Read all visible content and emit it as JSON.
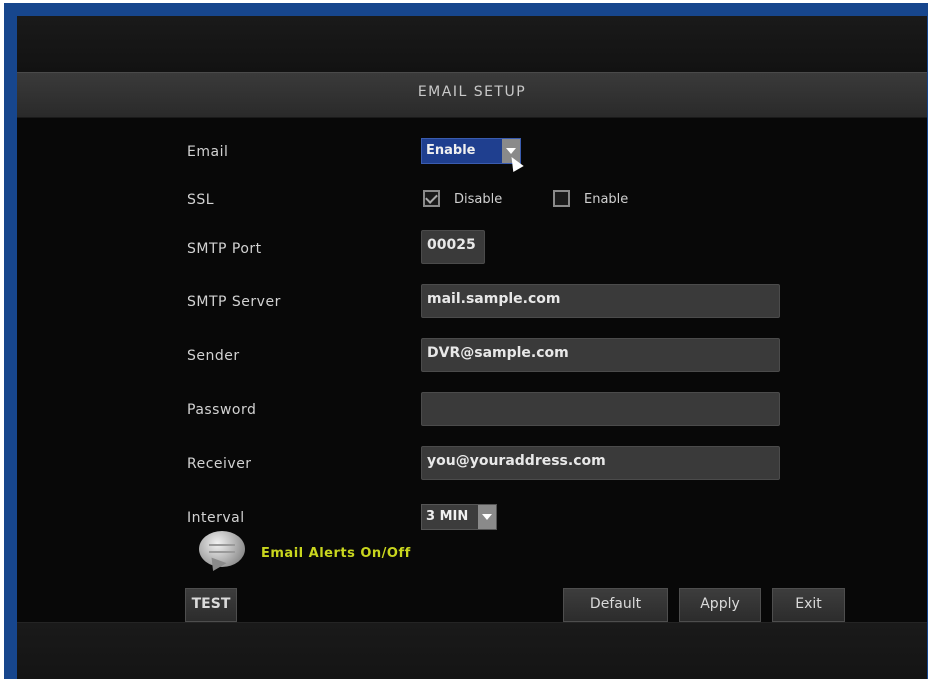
{
  "title": "EMAIL SETUP",
  "fields": {
    "email": {
      "label": "Email",
      "value": "Enable"
    },
    "ssl": {
      "label": "SSL",
      "option_disable": "Disable",
      "option_enable": "Enable",
      "checked": "Disable"
    },
    "smtp_port": {
      "label": "SMTP Port",
      "value": "00025"
    },
    "smtp_server": {
      "label": "SMTP Server",
      "value": "mail.sample.com"
    },
    "sender": {
      "label": "Sender",
      "value": "DVR@sample.com"
    },
    "password": {
      "label": "Password",
      "value": ""
    },
    "receiver": {
      "label": "Receiver",
      "value": "you@youraddress.com"
    },
    "interval": {
      "label": "Interval",
      "value": "3 MIN"
    }
  },
  "alerts": {
    "text": "Email Alerts On/Off",
    "icon": "speech-bubble-icon"
  },
  "buttons": {
    "test": "TEST",
    "default": "Default",
    "apply": "Apply",
    "exit": "Exit"
  },
  "colors": {
    "frame": "#17468d",
    "background": "#080808",
    "accent_select": "#1f3f8f",
    "alert_text": "#c9d61e"
  }
}
